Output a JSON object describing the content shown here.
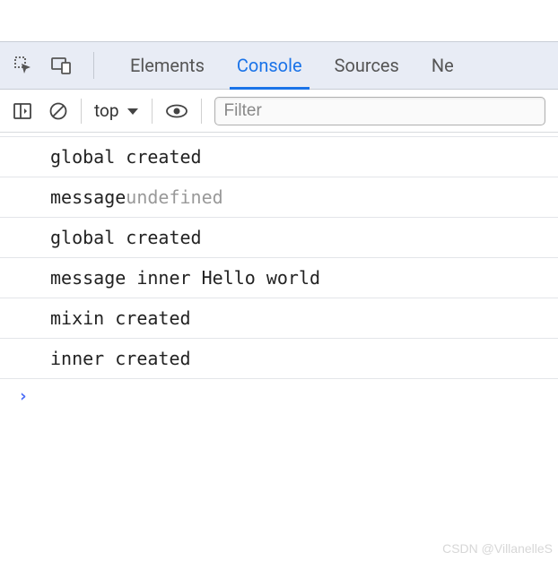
{
  "tabs": {
    "elements": "Elements",
    "console": "Console",
    "sources": "Sources",
    "network_partial": "Ne"
  },
  "toolbar": {
    "context": "top",
    "filter_placeholder": "Filter"
  },
  "logs": [
    {
      "parts": [
        {
          "text": "global created",
          "cls": ""
        }
      ]
    },
    {
      "parts": [
        {
          "text": "message ",
          "cls": ""
        },
        {
          "text": "undefined",
          "cls": "undefined"
        }
      ]
    },
    {
      "parts": [
        {
          "text": "global created",
          "cls": ""
        }
      ]
    },
    {
      "parts": [
        {
          "text": "message inner Hello world",
          "cls": ""
        }
      ]
    },
    {
      "parts": [
        {
          "text": "mixin created",
          "cls": ""
        }
      ]
    },
    {
      "parts": [
        {
          "text": "inner created",
          "cls": ""
        }
      ]
    }
  ],
  "prompt": "›",
  "watermark": "CSDN @VillanelleS"
}
